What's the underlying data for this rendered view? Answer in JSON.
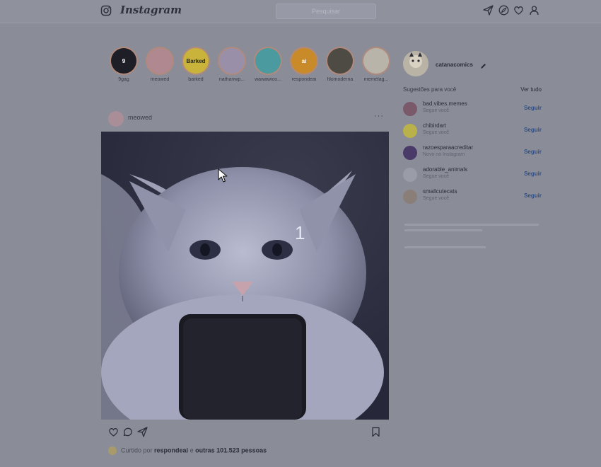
{
  "header": {
    "logo_text": "Instagram",
    "search_placeholder": "Pesquisar",
    "icons": [
      "instagram-camera-icon",
      "direct-send-icon",
      "explore-compass-icon",
      "activity-heart-icon",
      "profile-icon"
    ]
  },
  "stories": [
    {
      "name": "9gag",
      "logo": "9",
      "bg": "#1e1f26",
      "fg": "#ffffff"
    },
    {
      "name": "meowed",
      "logo": "",
      "bg": "#b08890",
      "fg": "#ffffff"
    },
    {
      "name": "barked",
      "logo": "Barked",
      "bg": "#c9b33a",
      "fg": "#2a2a10"
    },
    {
      "name": "nathanwp...",
      "logo": "",
      "bg": "#9a8fa8",
      "fg": "#ffffff"
    },
    {
      "name": "wawawico...",
      "logo": "",
      "bg": "#4a9aa0",
      "fg": "#ffffff"
    },
    {
      "name": "respondeai",
      "logo": "ai",
      "bg": "#c98a2a",
      "fg": "#ffffff"
    },
    {
      "name": "filomoderna",
      "logo": "",
      "bg": "#4e4a44",
      "fg": "#ffffff"
    },
    {
      "name": "memelag...",
      "logo": "",
      "bg": "#b8b4aa",
      "fg": "#ffffff"
    }
  ],
  "post": {
    "username": "meowed",
    "more": "···",
    "overlay_number": "1",
    "liked_by_prefix": "Curtido por",
    "liked_by_user": "respondeai",
    "liked_by_conj": "e",
    "liked_by_others": "outras 101.523 pessoas"
  },
  "profile": {
    "username": "catanacomics"
  },
  "suggestions": {
    "title": "Sugestões para você",
    "see_all": "Ver tudo",
    "follow_label": "Seguir",
    "items": [
      {
        "username": "bad.vibes.memes",
        "subtitle": "Segue você",
        "color": "#7a5a6a"
      },
      {
        "username": "chibirdart",
        "subtitle": "Segue você",
        "color": "#b9b24a"
      },
      {
        "username": "razoesparaacreditar",
        "subtitle": "Novo no Instagram",
        "color": "#4a3a6a"
      },
      {
        "username": "adorable_animals",
        "subtitle": "Segue você",
        "color": "#9a9ca8"
      },
      {
        "username": "smallcutecats",
        "subtitle": "Segue você",
        "color": "#8a7e78"
      }
    ]
  },
  "colors": {
    "background": "#8a8c98",
    "link_blue": "#2f4f86"
  }
}
